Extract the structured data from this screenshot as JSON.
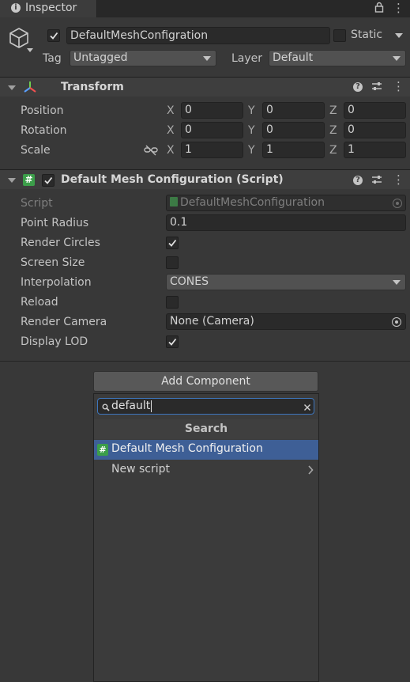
{
  "window": {
    "tab_title": "Inspector",
    "menu_glyph": "⋮",
    "info_glyph": "i"
  },
  "gameobject": {
    "name": "DefaultMeshConfigration",
    "active": true,
    "static_label": "Static",
    "static_checked": false,
    "tag_label": "Tag",
    "tag_value": "Untagged",
    "layer_label": "Layer",
    "layer_value": "Default"
  },
  "transform": {
    "title": "Transform",
    "position_label": "Position",
    "rotation_label": "Rotation",
    "scale_label": "Scale",
    "x": "X",
    "y": "Y",
    "z": "Z",
    "position": [
      "0",
      "0",
      "0"
    ],
    "rotation": [
      "0",
      "0",
      "0"
    ],
    "scale": [
      "1",
      "1",
      "1"
    ]
  },
  "script_component": {
    "title": "Default Mesh Configuration (Script)",
    "enabled": true,
    "script_label": "Script",
    "script_value": "DefaultMeshConfiguration",
    "point_radius_label": "Point Radius",
    "point_radius_value": "0.1",
    "render_circles_label": "Render Circles",
    "render_circles": true,
    "screen_size_label": "Screen Size",
    "screen_size": false,
    "interpolation_label": "Interpolation",
    "interpolation_value": "CONES",
    "reload_label": "Reload",
    "reload": false,
    "render_camera_label": "Render Camera",
    "render_camera_value": "None (Camera)",
    "display_lod_label": "Display LOD",
    "display_lod": true
  },
  "add_component": {
    "button_label": "Add Component",
    "search_value": "default",
    "header": "Search",
    "results": [
      {
        "label": "Default Mesh Configuration",
        "selected": true
      },
      {
        "label": "New script",
        "selected": false,
        "has_submenu": true
      }
    ]
  },
  "colors": {
    "background": "#383838",
    "selection": "#3e5f96",
    "search_focus": "#3d76bd",
    "script_icon": "#3c9e4a"
  }
}
